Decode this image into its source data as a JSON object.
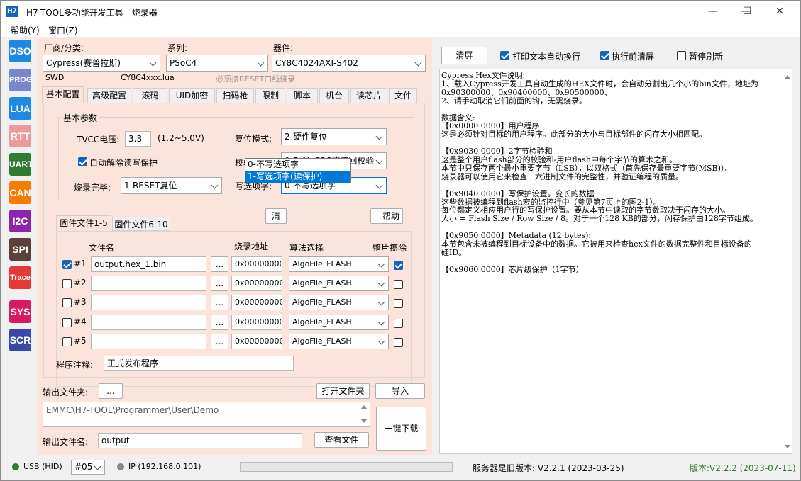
{
  "window": {
    "title": "H7-TOOL多功能开发工具 - 烧录器",
    "icon": "H7",
    "minimize": "—",
    "maximize": "☐",
    "close": "✕"
  },
  "menu": [
    "帮助(Y)",
    "窗口(Z)"
  ],
  "sidebar": [
    "DSO",
    "PROG",
    "LUA",
    "RTT",
    "UART",
    "CAN",
    "I2C",
    "SPI",
    "Trace",
    "SYS",
    "SCR"
  ],
  "sidebar_colors": [
    "#1e88e5",
    "#7986cb",
    "#1e88e5",
    "#ef9a9a",
    "#2e7d32",
    "#f57c00",
    "#8e24aa",
    "#5d4037",
    "#e53935",
    "#d81b60",
    "#3949ab"
  ],
  "top": {
    "vendor_label": "厂商/分类:",
    "vendor_value": "Cypress(赛普拉斯)",
    "series_label": "系列:",
    "series_value": "PSoC4",
    "device_label": "器件:",
    "device_value": "CY8C4024AXI-S402",
    "interface": "SWD",
    "lua_file": "CY8C4xxx.lua",
    "note": "必须接RESET口线烧录"
  },
  "tabs": [
    "基本配置",
    "高级配置",
    "滚码",
    "UID加密",
    "扫码枪",
    "限制",
    "脚本",
    "机台",
    "读芯片",
    "文件"
  ],
  "basic": {
    "group_title": "基本参数",
    "tvcc_label": "TVCC电压:",
    "tvcc_value": "3.3",
    "tvcc_range": "(1.2~5.0V)",
    "reset_label": "复位模式:",
    "reset_value": "2-硬件复位",
    "auto_unlock_label": "自动解除读写保护",
    "verify_label": "校验方式:",
    "verify_value": "0-FLM_CRC或读回校验",
    "done_label": "烧录完毕:",
    "done_value": "1-RESET复位",
    "option_label": "写选项字:",
    "option_value": "0-不写选项字",
    "option_list": [
      "0-不写选项字",
      "1-写选项字(读保护)"
    ],
    "hidden_btn1": "清",
    "hidden_btn2": "帮助"
  },
  "files": {
    "tab1": "固件文件1-5",
    "tab2": "固件文件6-10",
    "headers": {
      "name": "文件名",
      "addr": "烧录地址",
      "algo": "算法选择",
      "erase": "整片擦除"
    },
    "rows": [
      {
        "index": "#1",
        "checked": true,
        "name": "output.hex_1.bin",
        "browse": "...",
        "addr": "0x00000000",
        "algo": "AlgoFile_FLASH",
        "erase": true
      },
      {
        "index": "#2",
        "checked": false,
        "name": "",
        "browse": "...",
        "addr": "0x00000000",
        "algo": "AlgoFile_FLASH",
        "erase": false
      },
      {
        "index": "#3",
        "checked": false,
        "name": "",
        "browse": "...",
        "addr": "0x00000000",
        "algo": "AlgoFile_FLASH",
        "erase": false
      },
      {
        "index": "#4",
        "checked": false,
        "name": "",
        "browse": "...",
        "addr": "0x00000000",
        "algo": "AlgoFile_FLASH",
        "erase": false
      },
      {
        "index": "#5",
        "checked": false,
        "name": "",
        "browse": "...",
        "addr": "0x00000000",
        "algo": "AlgoFile_FLASH",
        "erase": false
      }
    ]
  },
  "comment": {
    "label": "程序注释:",
    "value": "正式发布程序"
  },
  "output": {
    "folder_label": "输出文件夹:",
    "folder_btn": "...",
    "open_btn": "打开文件夹",
    "import_btn": "导入",
    "path": "EMMC\\H7-TOOL\\Programmer\\User\\Demo",
    "name_label": "输出文件名:",
    "name_value": "output",
    "view_btn": "查看文件",
    "oneclick_btn": "一键下载"
  },
  "right": {
    "clear_btn": "清屏",
    "wrap_label": "打印文本自动换行",
    "preclear_label": "执行前清屏",
    "pause_label": "暂停刷新",
    "wrap_checked": true,
    "preclear_checked": true,
    "pause_checked": false,
    "log": [
      "Cypress Hex文件说明:",
      "1、载入Cypress开发工具自动生成的HEX文件时，会自动分割出几个小的bin文件，地址为",
      "0x90300000、0x90400000、0x90500000、",
      "2、请手动取消它们前面的钩，无需烧录。",
      "",
      "数据含义:",
      "【0x0000 0000】用户程序",
      "这是必须针对目标的用户程序。此部分的大小与目标部件的闪存大小相匹配。",
      "",
      "【0x9030 0000】2字节检验和",
      "这是整个用户flash部分的校验和-用户flash中每个字节的算术之和。",
      "本节中只保存两个最小重要字节（LSB），以双格式（首先保存最重要字节(MSB)）。",
      "烧录器可以使用它来检查十六进制文件的完整性，并验证编程的质量。",
      "",
      "【0x9040 0000】写保护设置。变长的数据",
      "这些数据被编程到flash宏的监控行中（参见第7页上的图2-1）。",
      "每位都定义相应用户行的写保护设置。要从本节中读取的字节数取决于闪存的大小。",
      "大小 = Flash Size / Row Size / 8。对于一个128 KB的部分，闪存保护由128字节组成。",
      "",
      "【0x9050 0000】Metadata (12 bytes):",
      "本节包含未被编程到目标设备中的数据。它被用来检查hex文件的数据完整性和目标设备的",
      "硅ID。",
      "",
      "【0x9060 0000】芯片级保护（1字节）"
    ]
  },
  "status": {
    "usb": "USB (HID)",
    "port": "#05",
    "ip": "IP (192.168.0.101)",
    "server": "服务器是旧版本: V2.2.1 (2023-03-25)",
    "version": "版本:V2.2.2 (2023-07-11)",
    "usb_color": "#2e7d32",
    "ip_color": "#888888",
    "version_color": "#2e7d32"
  }
}
